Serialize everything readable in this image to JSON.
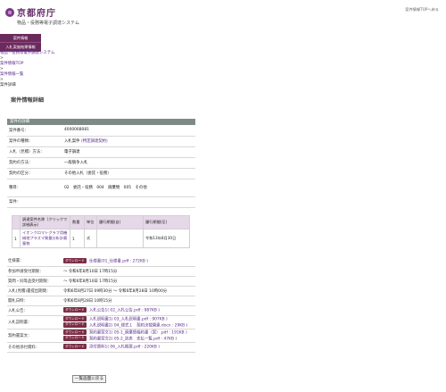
{
  "header": {
    "logo_text": "京都府庁",
    "system_name": "物品・役務等電子調達システム",
    "right_link": "案件情報TOPへ戻る"
  },
  "menu": {
    "items": [
      "案件情報",
      "入札実施結果情報"
    ]
  },
  "breadcrumb": {
    "items": [
      "物品・役務等電子調達システム",
      ">",
      "案件情報TOP",
      ">",
      "案件情報一覧",
      ">",
      "案件詳細"
    ]
  },
  "page_title": "案件情報詳細",
  "section_title": "案件の詳細",
  "info": [
    {
      "label": "案件番号：",
      "value": "4000068081"
    },
    {
      "label": "案件の種類：",
      "value": "入札案件",
      "extra": "(特定調達契約)"
    },
    {
      "label": "入札（見積）方法：",
      "value": "電子調達"
    },
    {
      "label": "契約の方法：",
      "value": "一般競争入札"
    },
    {
      "label": "契約の区分：",
      "value": "その他入札（委託・役務）"
    },
    {
      "label": "種目：",
      "value": "02　委託・役務　004　廃棄物　005　その他"
    },
    {
      "label": "案件：",
      "value": ""
    }
  ],
  "items_table": {
    "headers": [
      "",
      "調達案件名称（クリックで詳細表示）",
      "数量",
      "単位",
      "履行期間(自)",
      "履行期間(至)"
    ],
    "rows": [
      {
        "no": "1",
        "name": "イオンクロマトグラフ用機械他プラズマ質量分析計廃棄物",
        "qty": "1",
        "unit": "式",
        "from": "",
        "to": "令和13年8月30日"
      }
    ]
  },
  "details": {
    "badge": "ダウンロード",
    "shiyosho_label": "仕様書：",
    "shiyosho_file": "仕様書(01_仕様書.pdf : 272KB )",
    "sanka_label": "参加申請受付期限：",
    "sanka_value": "～ 令和6年8月10日 17時15分",
    "shitsumon_label": "質問・同等品受付期限：",
    "shitsumon_value": "～ 令和6年8月10日 17時15分",
    "nyusatsu_label": "入札(見積)書提出期間：",
    "nyusatsu_value": "令和6年8月27日 09時30分 ～ 令和6年8月28日 10時00分",
    "kaisatsu_label": "開札日時：",
    "kaisatsu_value": "令和6年8月28日 10時15分",
    "koukoku_label": "入札公告：",
    "koukoku_file": "入札公告1( 02_入札公告.pdf : 987KB )",
    "setsumei_label": "入札説明書：",
    "setsumei_files": [
      "入札説明書1( 03_入札説明書.pdf : 907KB )",
      "入札説明書2( 04_様式１　契約決裁関連.docx : 29KB )"
    ],
    "keiyaku_label": "契約書案文：",
    "keiyaku_files": [
      "契約書案文1( 05-1_廃棄情報約書（案）.pdf : 191KB )",
      "契約書案文2( 05-2_別表　支払一覧.pdf : 47KB )"
    ],
    "sonota_label": "その他添付資料：",
    "sonota_file": "添付資料1( 06_入札概要.pdf : 220KB )"
  },
  "back_button": "一覧画面に戻る"
}
